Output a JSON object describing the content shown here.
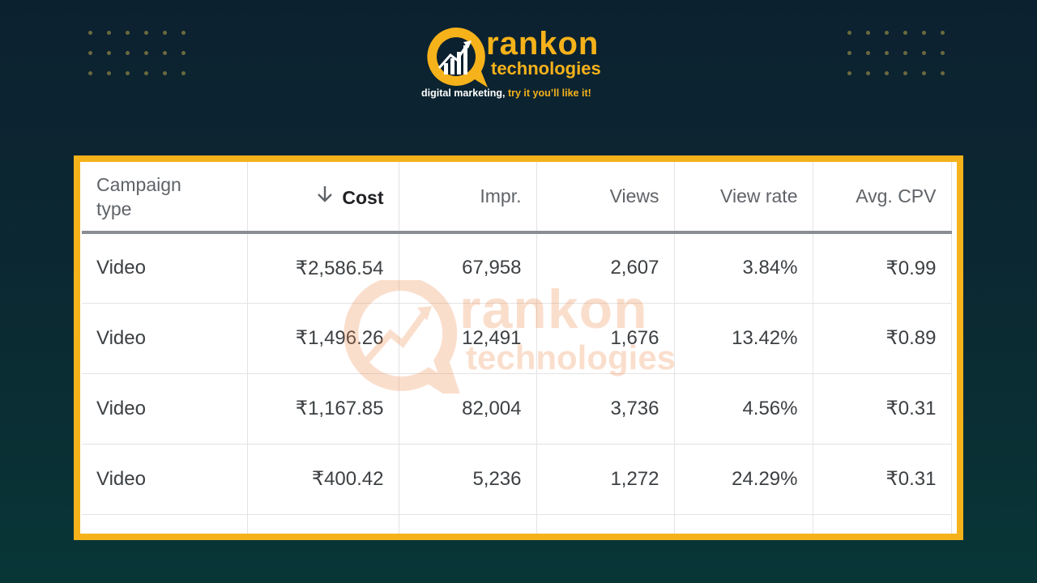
{
  "brand": {
    "name_line1": "rankon",
    "name_line2": "technologies",
    "tagline_part1": "digital marketing,",
    "tagline_part2": " try it you’ll like it!",
    "accent_color": "#f6b21a"
  },
  "watermark": {
    "line1": "rankon",
    "line2": "technologies"
  },
  "table": {
    "columns": [
      {
        "label": "Campaign type"
      },
      {
        "label": "Cost",
        "sort_icon": "arrow-down-icon"
      },
      {
        "label": "Impr."
      },
      {
        "label": "Views"
      },
      {
        "label": "View rate"
      },
      {
        "label": "Avg. CPV"
      }
    ],
    "rows": [
      [
        "Video",
        "₹2,586.54",
        "67,958",
        "2,607",
        "3.84%",
        "₹0.99"
      ],
      [
        "Video",
        "₹1,496.26",
        "12,491",
        "1,676",
        "13.42%",
        "₹0.89"
      ],
      [
        "Video",
        "₹1,167.85",
        "82,004",
        "3,736",
        "4.56%",
        "₹0.31"
      ],
      [
        "Video",
        "₹400.42",
        "5,236",
        "1,272",
        "24.29%",
        "₹0.31"
      ]
    ]
  }
}
